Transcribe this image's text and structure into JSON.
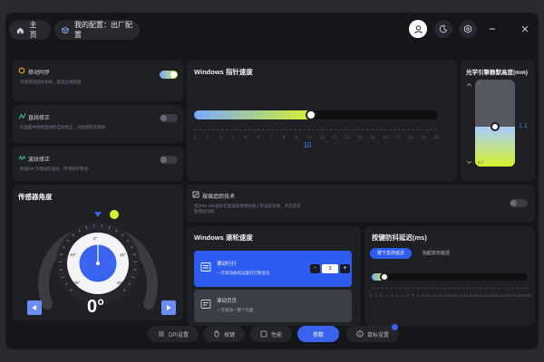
{
  "header": {
    "home_label": "主页",
    "config_label": "我的配置：出厂配置"
  },
  "motion_sync": {
    "title": "移动同步",
    "desc": "可能增加鼠标功耗，提高丝滑程度"
  },
  "straight_line": {
    "title": "直线修正",
    "desc": "在画面中绘制直线时自动修正，对绘图较有帮助"
  },
  "ripple": {
    "title": "波纹修正",
    "desc": "降低DPI下增加的波纹，平滑指针移动"
  },
  "pointer_speed": {
    "title": "Windows 指针速度",
    "ticks": [
      "1",
      "2",
      "3",
      "4",
      "5",
      "6",
      "7",
      "8",
      "9",
      "10",
      "11",
      "12",
      "13",
      "14",
      "15",
      "16",
      "17",
      "18",
      "19",
      "20"
    ],
    "value": "10",
    "fraction": 0.45
  },
  "lod": {
    "title": "光学引擎静默高度(mm)",
    "top_label": "2",
    "bottom_label": "0.7",
    "value": "1.1",
    "fraction": 0.31
  },
  "angle": {
    "title": "传感器角度",
    "value": "0°",
    "gauge_labels": {
      "top": "0°",
      "left_upper": "-15°",
      "right_upper": "15°",
      "left_lower": "-30°",
      "right_lower": "30°"
    }
  },
  "glass": {
    "title": "玻璃追踪技术",
    "desc": "提升8K DPI鼠标在玻璃等透明材质上的追踪效果，开启后可能增加功耗"
  },
  "scroll": {
    "title": "Windows 滚轮速度",
    "option1_title": "滚动行行",
    "option1_desc": "一次滚动按照设置的行数变化",
    "option1_value": "3",
    "option2_title": "滚动页页",
    "option2_desc": "一次滚动一整个页面"
  },
  "debounce": {
    "title": "按键防抖延迟(ms)",
    "mode_down": "按下去抖延迟",
    "mode_up": "抬起去抖延迟",
    "ticks": [
      "0",
      "1",
      "2",
      "3",
      "4",
      "5",
      "6",
      "7",
      "8",
      "9",
      "10",
      "11",
      "12",
      "13",
      "14",
      "15",
      "16",
      "17",
      "18",
      "19",
      "20",
      "21",
      "22",
      "23",
      "24",
      "25",
      "26",
      "27",
      "28",
      "29",
      "30"
    ],
    "fraction": 0.04
  },
  "tabs": [
    {
      "label": "DPI设置"
    },
    {
      "label": "按键"
    },
    {
      "label": "性能"
    },
    {
      "label": "参数"
    },
    {
      "label": "鼠标设置"
    }
  ],
  "colors": {
    "accent": "#3a63f0",
    "gradient_start": "#7aa8ff",
    "gradient_end": "#c8f04a",
    "warning": "#f0a020"
  }
}
